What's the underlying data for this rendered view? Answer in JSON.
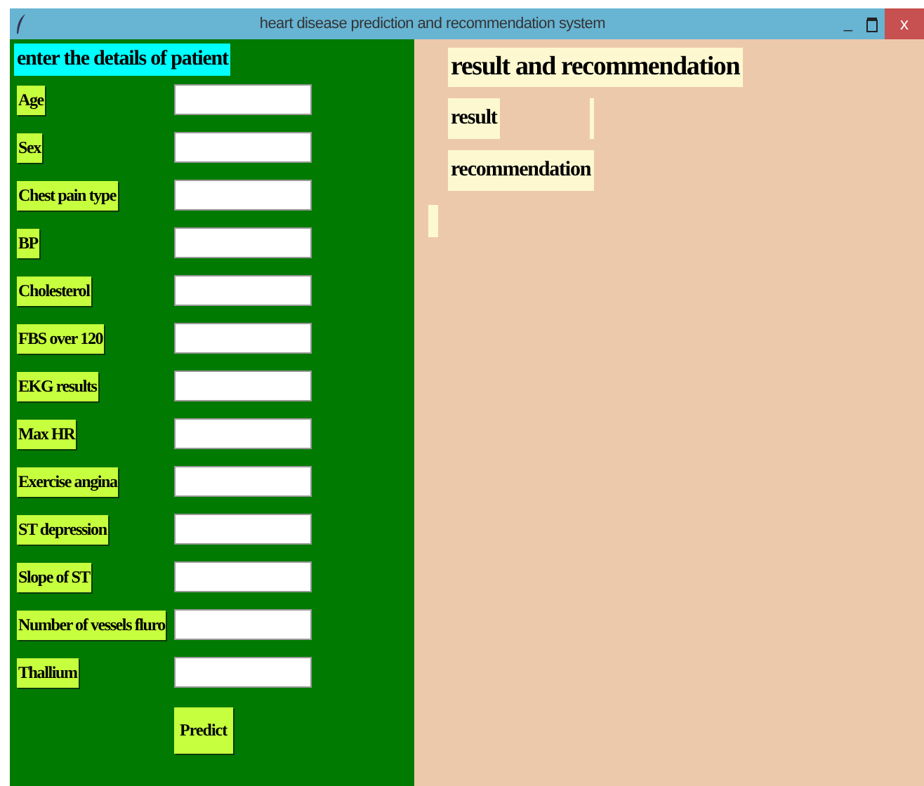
{
  "window": {
    "title": "heart disease prediction and recommendation system",
    "controls": [
      "_",
      "x"
    ]
  },
  "input_panel": {
    "heading": "enter the details of patient",
    "fields": [
      {
        "label": "Age"
      },
      {
        "label": "Sex"
      },
      {
        "label": "Chest pain type"
      },
      {
        "label": "BP"
      },
      {
        "label": "Cholesterol"
      },
      {
        "label": "FBS over 120"
      },
      {
        "label": "EKG results"
      },
      {
        "label": "Max HR"
      },
      {
        "label": "Exercise angina"
      },
      {
        "label": "ST depression"
      },
      {
        "label": "Slope of ST"
      },
      {
        "label": "Number of vessels fluro"
      },
      {
        "label": "Thallium"
      }
    ],
    "button": "Predict"
  },
  "result_panel": {
    "heading": "result and recommendation",
    "result_label": "result",
    "recommendation_label": "recommendation"
  }
}
